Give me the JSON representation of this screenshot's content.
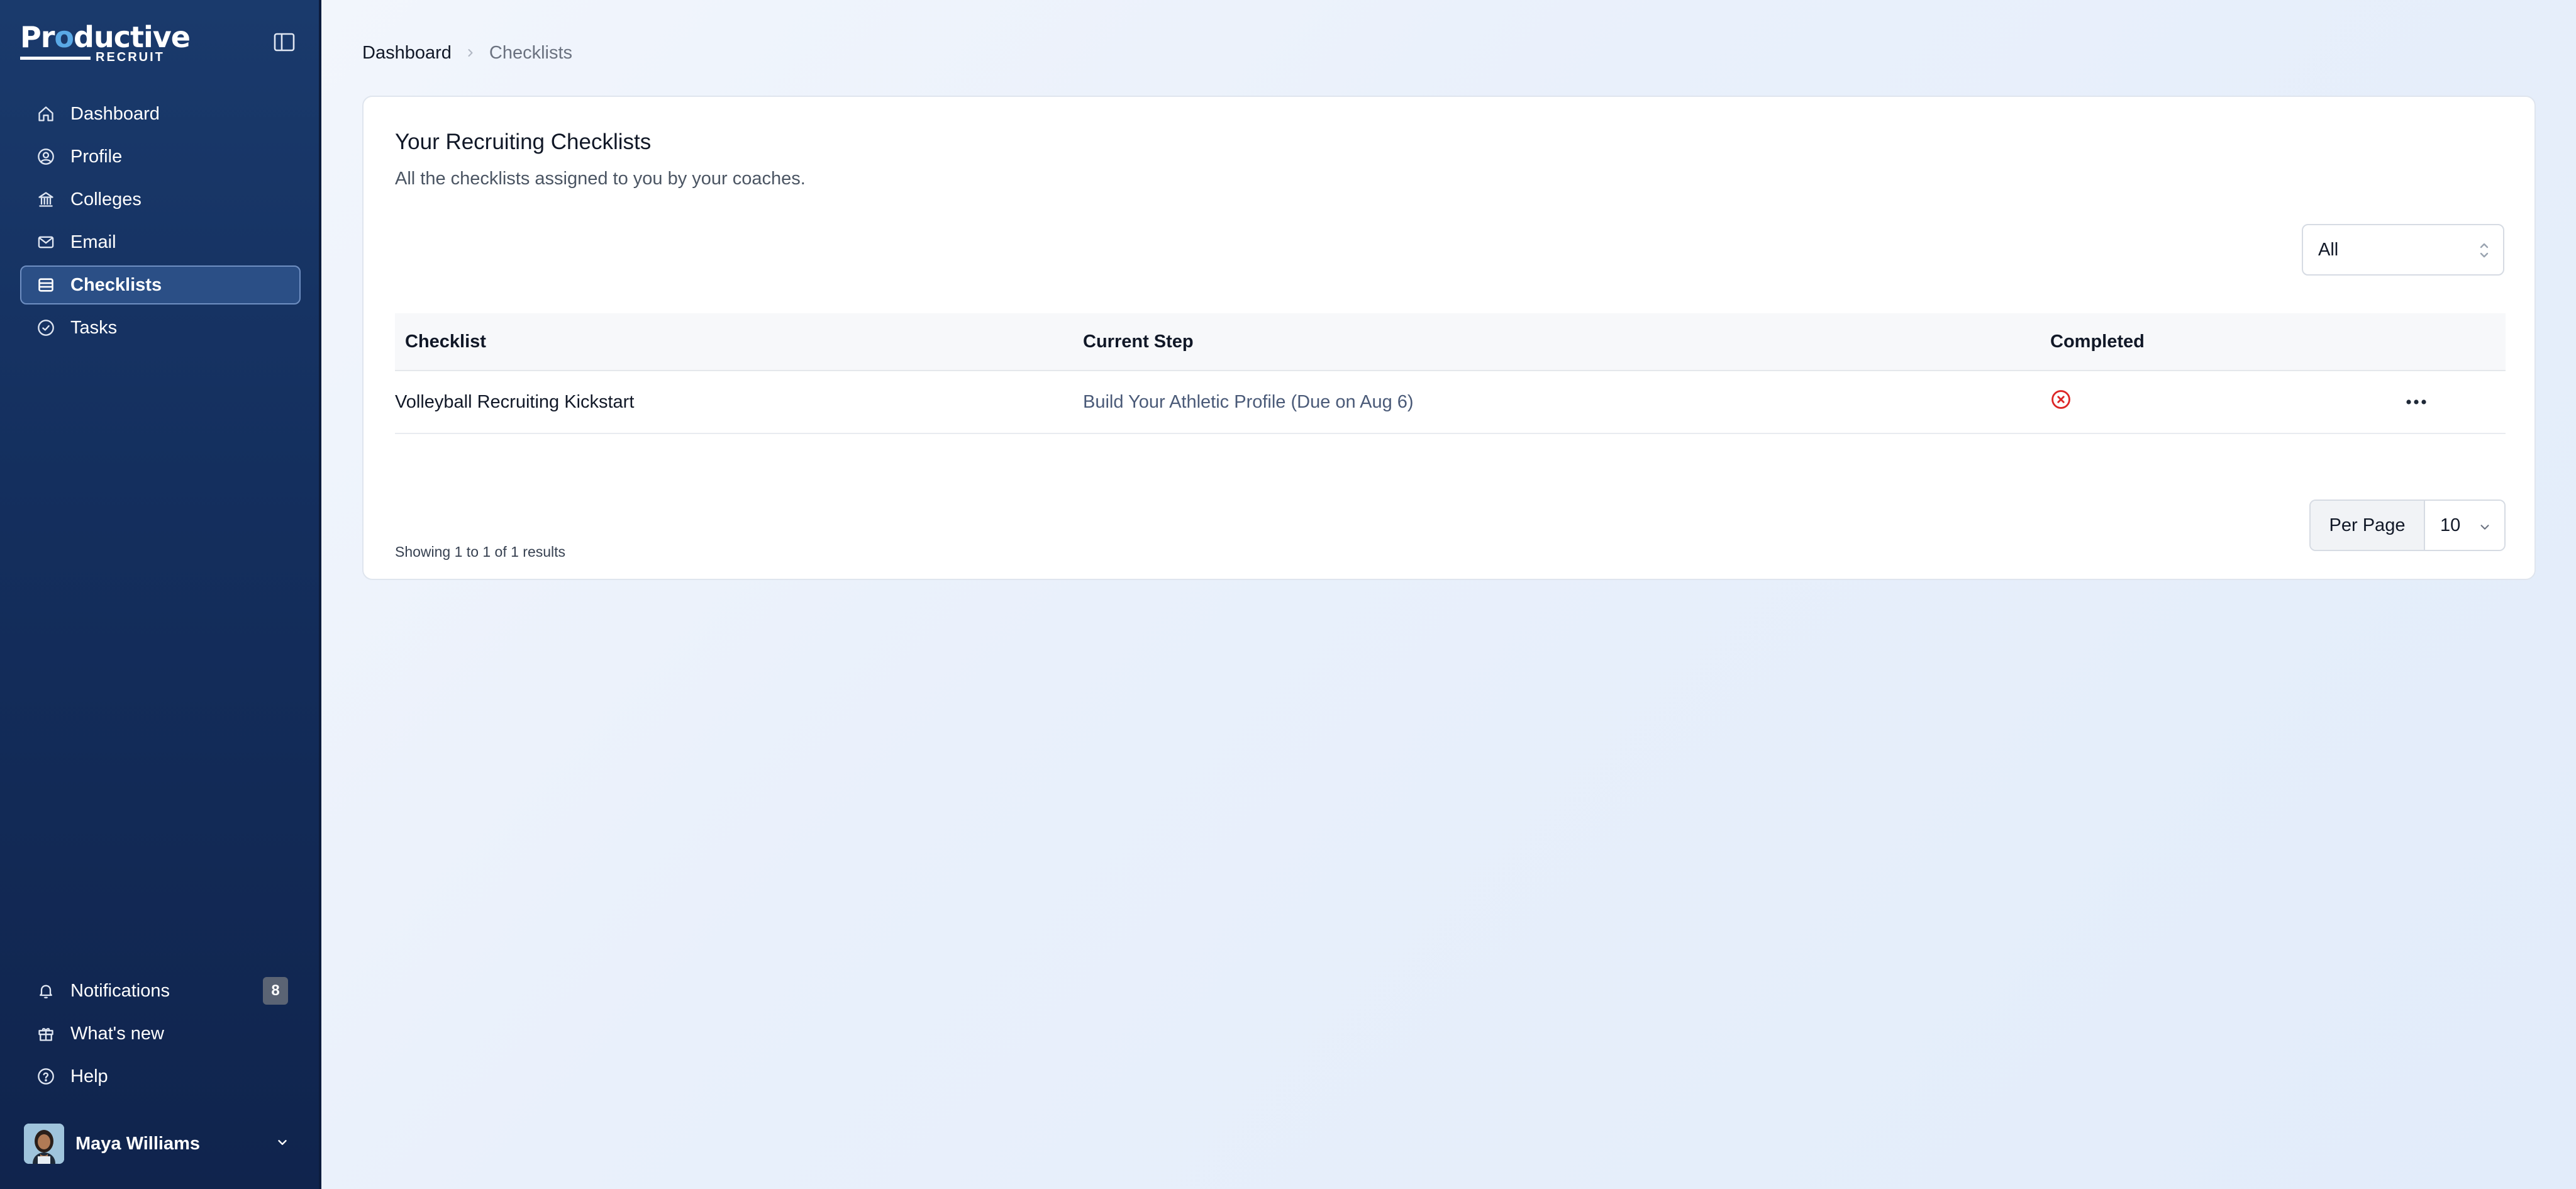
{
  "app": {
    "brand_word": "Productive",
    "brand_sub": "RECRUIT"
  },
  "sidebar": {
    "items": [
      {
        "label": "Dashboard",
        "icon": "home-icon"
      },
      {
        "label": "Profile",
        "icon": "user-circle-icon"
      },
      {
        "label": "Colleges",
        "icon": "building-icon"
      },
      {
        "label": "Email",
        "icon": "mail-icon"
      },
      {
        "label": "Checklists",
        "icon": "list-icon",
        "active": true
      },
      {
        "label": "Tasks",
        "icon": "check-circle-icon"
      }
    ],
    "bottom_items": [
      {
        "label": "Notifications",
        "icon": "bell-icon",
        "badge": "8"
      },
      {
        "label": "What's new",
        "icon": "gift-icon"
      },
      {
        "label": "Help",
        "icon": "help-circle-icon"
      }
    ],
    "user": {
      "name": "Maya Williams"
    }
  },
  "breadcrumb": {
    "home": "Dashboard",
    "current": "Checklists"
  },
  "card": {
    "title": "Your Recruiting Checklists",
    "subtitle": "All the checklists assigned to you by your coaches.",
    "filter_value": "All"
  },
  "table": {
    "columns": [
      "Checklist",
      "Current Step",
      "Completed"
    ],
    "rows": [
      {
        "checklist": "Volleyball Recruiting Kickstart",
        "current_step": "Build Your Athletic Profile (Due on Aug 6)",
        "completed": false
      }
    ],
    "showing": "Showing 1 to 1 of 1 results"
  },
  "pagination": {
    "per_page_label": "Per Page",
    "per_page_value": "10"
  },
  "colors": {
    "sidebar_bg": "#142f5e",
    "active_item_bg": "#2b4f86",
    "incomplete_red": "#dc2626"
  }
}
